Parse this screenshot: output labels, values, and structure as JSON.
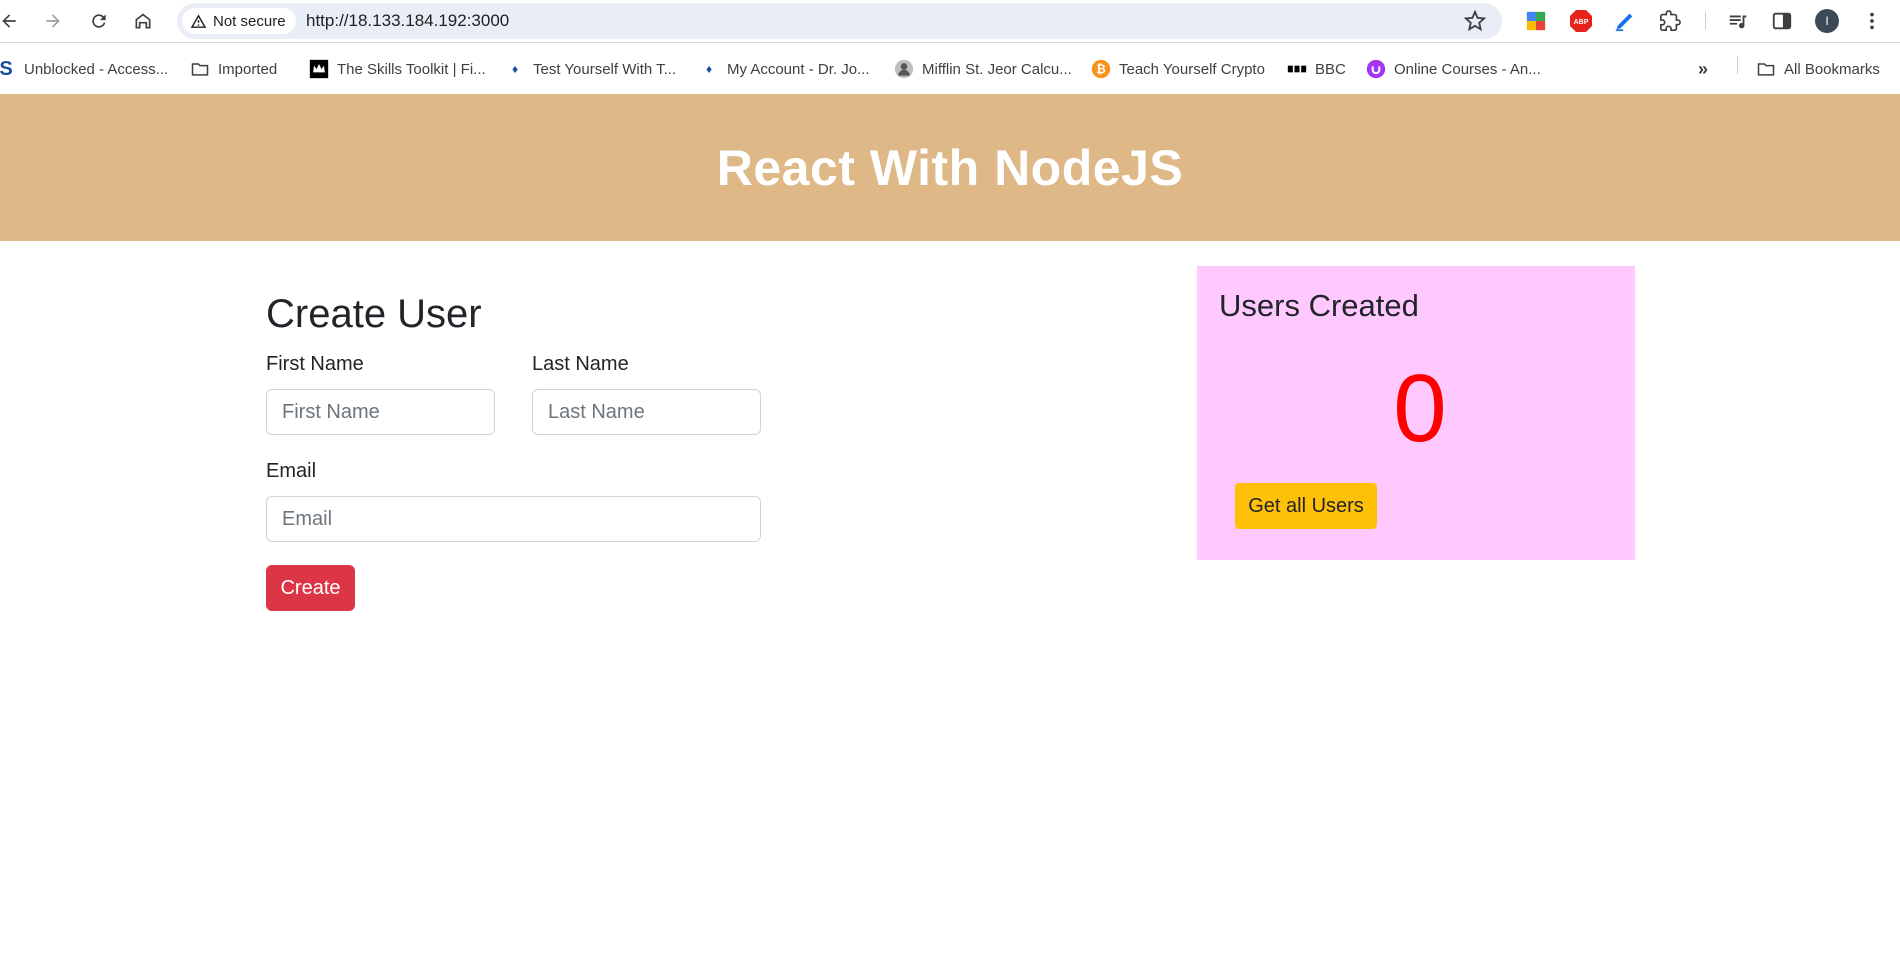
{
  "browser": {
    "security_label": "Not secure",
    "url": "http://18.133.184.192:3000",
    "bookmarks": [
      {
        "label": "Unblocked - Access...",
        "icon": "s-logo-icon"
      },
      {
        "label": "Imported",
        "icon": "folder-icon"
      },
      {
        "label": "The Skills Toolkit | Fi...",
        "icon": "crown-icon"
      },
      {
        "label": "Test Yourself With T...",
        "icon": "playstation-icon"
      },
      {
        "label": "My Account - Dr. Jo...",
        "icon": "playstation-icon"
      },
      {
        "label": "Mifflin St. Jeor Calcu...",
        "icon": "avatar-icon"
      },
      {
        "label": "Teach Yourself Crypto",
        "icon": "bitcoin-icon"
      },
      {
        "label": "BBC",
        "icon": "bbc-icon"
      },
      {
        "label": "Online Courses - An...",
        "icon": "udemy-icon"
      }
    ],
    "all_bookmarks_label": "All Bookmarks",
    "profile_initial": "I"
  },
  "page": {
    "header_title": "React With NodeJS",
    "form": {
      "title": "Create User",
      "first_name_label": "First Name",
      "first_name_placeholder": "First Name",
      "first_name_value": "",
      "last_name_label": "Last Name",
      "last_name_placeholder": "Last Name",
      "last_name_value": "",
      "email_label": "Email",
      "email_placeholder": "Email",
      "email_value": "",
      "create_label": "Create"
    },
    "users": {
      "title": "Users Created",
      "count": "0",
      "button_label": "Get all Users"
    }
  },
  "colors": {
    "header_bg": "#deb887",
    "card_bg": "#ffc8ff",
    "count_color": "#ff0000",
    "create_btn": "#dc3545",
    "get_btn": "#ffc107"
  }
}
